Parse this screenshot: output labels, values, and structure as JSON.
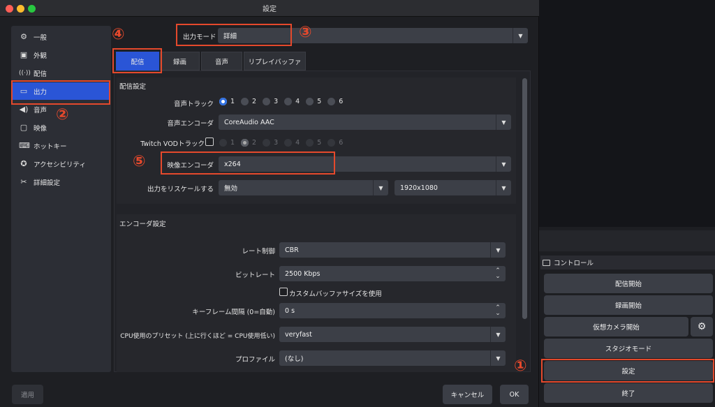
{
  "window": {
    "title": "設定"
  },
  "sidebar": {
    "items": [
      {
        "label": "一般",
        "icon": "gear-icon"
      },
      {
        "label": "外観",
        "icon": "appearance-icon"
      },
      {
        "label": "配信",
        "icon": "broadcast-icon"
      },
      {
        "label": "出力",
        "icon": "output-icon",
        "selected": true
      },
      {
        "label": "音声",
        "icon": "speaker-icon"
      },
      {
        "label": "映像",
        "icon": "monitor-icon"
      },
      {
        "label": "ホットキー",
        "icon": "keyboard-icon"
      },
      {
        "label": "アクセシビリティ",
        "icon": "accessibility-icon"
      },
      {
        "label": "詳細設定",
        "icon": "tools-icon"
      }
    ]
  },
  "output_mode": {
    "label": "出力モード",
    "value": "詳細"
  },
  "tabs": [
    "配信",
    "録画",
    "音声",
    "リプレイバッファ"
  ],
  "stream_settings": {
    "title": "配信設定",
    "audio_track_label": "音声トラック",
    "tracks": [
      "1",
      "2",
      "3",
      "4",
      "5",
      "6"
    ],
    "selected_track": "1",
    "audio_encoder_label": "音声エンコーダ",
    "audio_encoder_value": "CoreAudio AAC",
    "vod_track_label": "Twitch VODトラック",
    "vod_selected_track": "2",
    "video_encoder_label": "映像エンコーダ",
    "video_encoder_value": "x264",
    "rescale_label": "出力をリスケールする",
    "rescale_value": "無効",
    "rescale_resolution": "1920x1080"
  },
  "encoder_settings": {
    "title": "エンコーダ設定",
    "rate_control_label": "レート制御",
    "rate_control_value": "CBR",
    "bitrate_label": "ビットレート",
    "bitrate_value": "2500 Kbps",
    "custom_buffer_label": "カスタムバッファサイズを使用",
    "keyframe_label": "キーフレーム間隔 (0=自動)",
    "keyframe_value": "0 s",
    "preset_label": "CPU使用のプリセット (上に行くほど = CPU使用低い)",
    "preset_value": "veryfast",
    "profile_label": "プロファイル",
    "profile_value": "(なし)"
  },
  "footer": {
    "apply": "適用",
    "cancel": "キャンセル",
    "ok": "OK"
  },
  "controls": {
    "title": "コントロール",
    "buttons": [
      "配信開始",
      "録画開始",
      "仮想カメラ開始",
      "スタジオモード",
      "設定",
      "終了"
    ]
  },
  "annotations": [
    "①",
    "②",
    "③",
    "④",
    "⑤"
  ],
  "colors": {
    "accent": "#2a55d6",
    "highlight": "#e5492c",
    "close": "#ff5f57",
    "minimize": "#febc2e",
    "zoom": "#28c840"
  }
}
